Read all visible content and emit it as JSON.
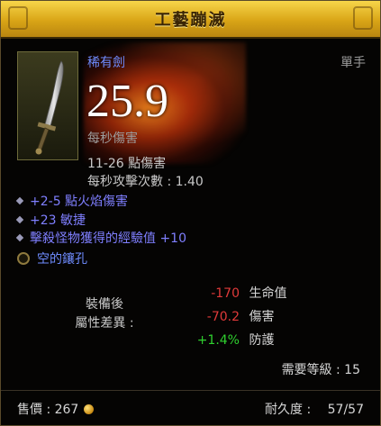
{
  "title": "工藝蹦滅",
  "item": {
    "type": "稀有劍",
    "slot": "單手",
    "dps": "25.9",
    "dps_label": "每秒傷害",
    "damage_range": "11-26 點傷害",
    "attack_speed": "每秒攻擊次數 : 1.40"
  },
  "affixes": [
    "+2-5 點火焰傷害",
    "+23 敏捷",
    "擊殺怪物獲得的經驗值 +10"
  ],
  "socket_label": "空的鑲孔",
  "compare": {
    "label_line1": "裝備後",
    "label_line2": "屬性差異 :",
    "stats": [
      {
        "value": "-170",
        "name": "生命值",
        "color": "#e03a3a"
      },
      {
        "value": "-70.2",
        "name": "傷害",
        "color": "#e03a3a"
      },
      {
        "value": "+1.4%",
        "name": "防護",
        "color": "#2fd12f"
      }
    ]
  },
  "required_level": "需要等級 : 15",
  "footer": {
    "sell_price": "售價 : 267",
    "durability_label": "耐久度 :",
    "durability_value": "57/57"
  },
  "colors": {
    "title_bar": "#d9a516",
    "affix_blue": "#7f7fff",
    "negative": "#e03a3a",
    "positive": "#2fd12f"
  },
  "icons": {
    "item_icon": "sword-icon",
    "socket": "socket-ring-icon",
    "currency": "gold-coin-icon"
  }
}
